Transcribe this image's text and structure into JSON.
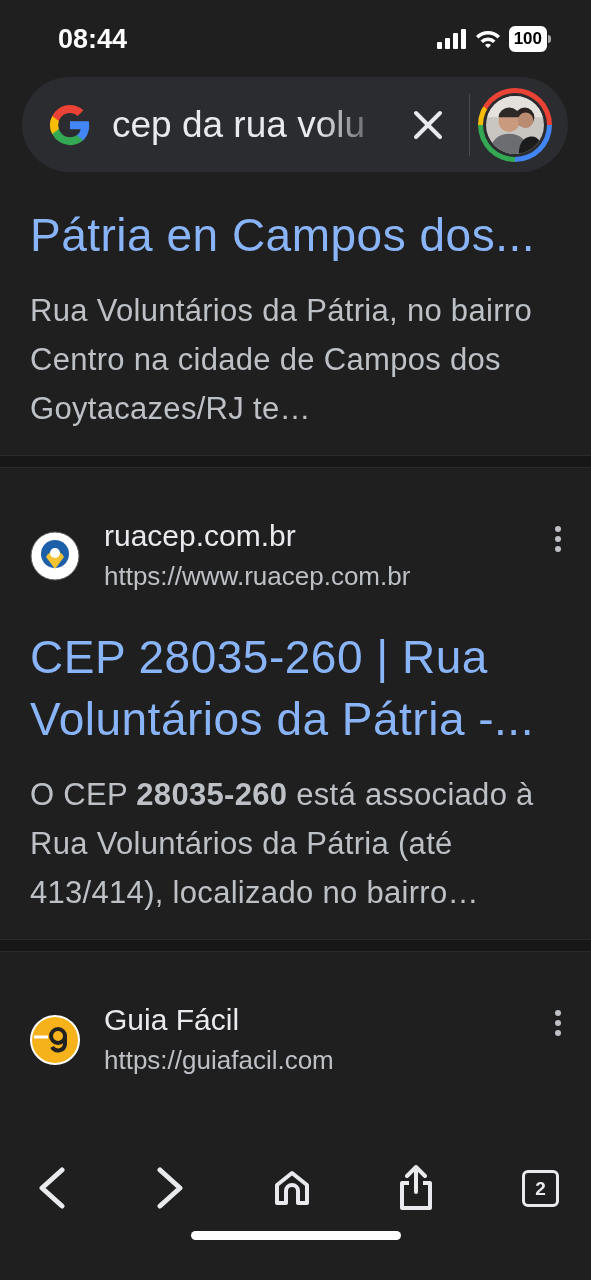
{
  "status_bar": {
    "time": "08:44",
    "battery": "100"
  },
  "search": {
    "value": "cep da rua volu"
  },
  "results": [
    {
      "title": "Pátria en Campos dos...",
      "snippet": "Rua Voluntários da Pátria, no bairro Centro na cidade de Campos dos Goytacazes/RJ te…"
    },
    {
      "site": "ruacep.com.br",
      "url": "https://www.ruacep.com.br",
      "title": "CEP 28035-260 | Rua Voluntários da Pátria -...",
      "snippet": "O CEP **28035-260** está associado à Rua Voluntários da Pátria (até 413/414), localizado no bairro…"
    },
    {
      "site": "Guia Fácil",
      "url": "https://guiafacil.com"
    }
  ],
  "toolbar": {
    "tab_count": "2"
  }
}
